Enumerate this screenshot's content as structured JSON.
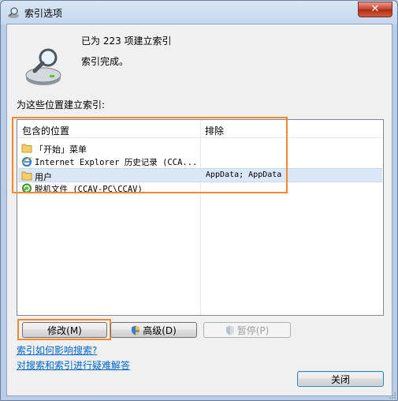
{
  "window": {
    "title": "索引选项",
    "close_glyph": "✕"
  },
  "status": {
    "count_text": "已为 223 项建立索引",
    "done_text": "索引完成。",
    "icon": "magnifier-over-drive-icon"
  },
  "locations": {
    "label": "为这些位置建立索引:",
    "headers": {
      "included": "包含的位置",
      "excluded": "排除"
    },
    "rows": [
      {
        "icon": "folder-icon",
        "name": "「开始」菜单",
        "excluded": ""
      },
      {
        "icon": "ie-icon",
        "name": "Internet Explorer 历史记录 (CCA...",
        "excluded": ""
      },
      {
        "icon": "folder-icon",
        "name": "用户",
        "excluded": "AppData; AppData",
        "selected": true
      },
      {
        "icon": "offline-files-icon",
        "name": "脱机文件 (CCAV-PC\\CCAV)",
        "excluded": ""
      }
    ]
  },
  "buttons": {
    "modify": "修改(M)",
    "advanced": "高级(D)",
    "pause": "暂停(P)",
    "close": "关闭"
  },
  "links": {
    "how_affects": "索引如何影响搜索?",
    "troubleshoot": "对搜索和索引进行疑难解答"
  },
  "colors": {
    "highlight": "#f08a2c",
    "link": "#0066cc",
    "selection": "#dae7f7"
  }
}
